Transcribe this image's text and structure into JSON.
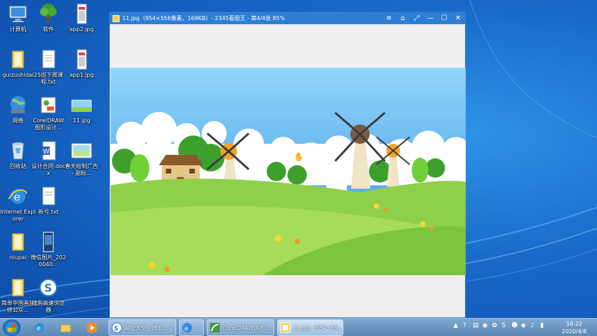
{
  "desktop": {
    "icons": [
      {
        "label": "计算机"
      },
      {
        "label": "软件"
      },
      {
        "label": "app2.jpg"
      },
      {
        "label": "guizushidai"
      },
      {
        "label": "25班下周课程.txt"
      },
      {
        "label": "app1.jpg"
      },
      {
        "label": "网络"
      },
      {
        "label": "CorelDRAW 图形设计..."
      },
      {
        "label": "11.jpg"
      },
      {
        "label": "回收站"
      },
      {
        "label": "设计合同.docx"
      },
      {
        "label": "春天绘制广告 - 副标..."
      },
      {
        "label": "Internet Explorer"
      },
      {
        "label": "新号.txt"
      },
      {
        "label": "niupai"
      },
      {
        "label": "微信图片_2020040..."
      },
      {
        "label": "简单中国画装修公众..."
      },
      {
        "label": "搜狗高速浏览器"
      }
    ]
  },
  "viewer": {
    "title": "11.jpg（954×556像素，169KB）- 2345看图王 - 第4/4张 85%",
    "buttons": [
      "≡",
      "⌂",
      "⤢",
      "—",
      "☐",
      "✕"
    ]
  },
  "taskbar": {
    "items": [
      {
        "label": "网址大全 - 搜狗..."
      },
      {
        "label": ""
      },
      {
        "label": "CorelDRAW X7 (..."
      },
      {
        "label": "11.jpg（954×55..."
      }
    ],
    "clock_time": "16:22",
    "clock_date": "2020/4/8"
  },
  "colors": {
    "accent": "#2d7fd6",
    "sky": "#7cc8f5",
    "grass": "#8fd04a"
  }
}
